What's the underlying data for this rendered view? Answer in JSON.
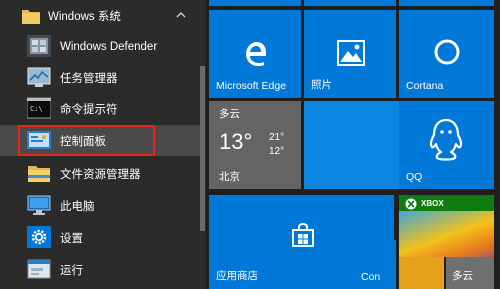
{
  "folder": {
    "label": "Windows 系统"
  },
  "apps": [
    {
      "label": "Windows Defender",
      "icon": "windows-defender-icon"
    },
    {
      "label": "任务管理器",
      "icon": "task-manager-icon"
    },
    {
      "label": "命令提示符",
      "icon": "command-prompt-icon"
    },
    {
      "label": "控制面板",
      "icon": "control-panel-icon"
    },
    {
      "label": "文件资源管理器",
      "icon": "file-explorer-icon"
    },
    {
      "label": "此电脑",
      "icon": "this-pc-icon"
    },
    {
      "label": "设置",
      "icon": "settings-icon"
    },
    {
      "label": "运行",
      "icon": "run-icon"
    }
  ],
  "tiles": {
    "edge": "Microsoft Edge",
    "photos": "照片",
    "cortana": "Cortana",
    "weather": {
      "condition": "多云",
      "temp": "13°",
      "high": "21°",
      "low": "12°",
      "city": "北京"
    },
    "qq": "QQ",
    "store": "应用商店",
    "con": "Con",
    "xbox": "XBOX",
    "weather2": "多云"
  },
  "colors": {
    "accent": "#0078d7",
    "highlight": "#e8241c",
    "xbox": "#107c10"
  }
}
